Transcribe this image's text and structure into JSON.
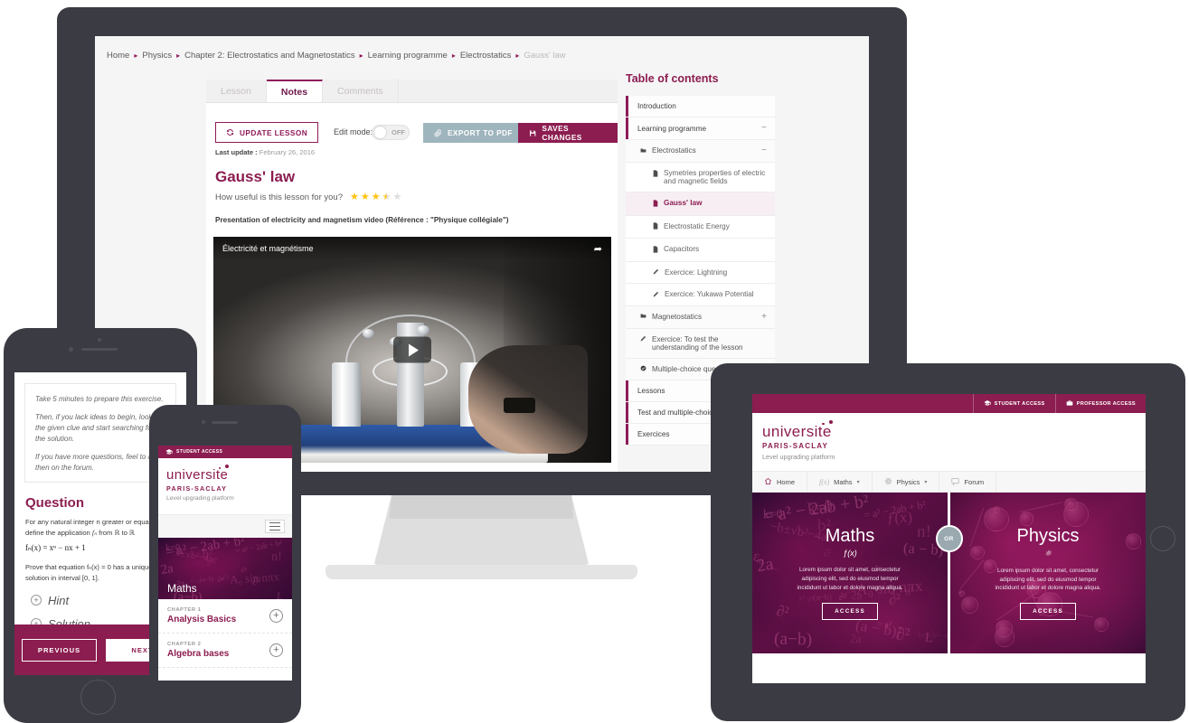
{
  "desktop": {
    "breadcrumb": [
      {
        "label": "Home",
        "current": false
      },
      {
        "label": "Physics",
        "current": false
      },
      {
        "label": "Chapter 2: Electrostatics and Magnetostatics",
        "current": false
      },
      {
        "label": "Learning programme",
        "current": false
      },
      {
        "label": "Electrostatics",
        "current": false
      },
      {
        "label": "Gauss' law",
        "current": true
      }
    ],
    "tabs": [
      {
        "label": "Lesson",
        "active": false
      },
      {
        "label": "Notes",
        "active": true
      },
      {
        "label": "Comments",
        "active": false
      }
    ],
    "toolbar": {
      "update_label": "UPDATE LESSON",
      "update_icon": "refresh-icon",
      "last_update_prefix": "Last update :",
      "last_update_value": "February 26, 2016",
      "edit_mode_label": "Edit mode:",
      "toggle_state": "OFF",
      "export_label": "EXPORT TO PDF",
      "export_icon": "paperclip-icon",
      "save_label": "SAVES CHANGES",
      "save_icon": "floppy-disk-icon"
    },
    "lesson": {
      "title": "Gauss' law",
      "rating_question": "How useful is this lesson for you?",
      "rating_value": 3.5,
      "rating_max": 5,
      "video_caption": "Presentation of electricity and magnetism video (Référence : \"Physique collégiale\")",
      "video_title": "Électricité et magnétisme"
    },
    "toc": {
      "title": "Table of contents",
      "items": [
        {
          "label": "Introduction",
          "level": 0,
          "icon": "",
          "toggle": "",
          "active": false
        },
        {
          "label": "Learning programme",
          "level": 0,
          "icon": "",
          "toggle": "−",
          "active": false
        },
        {
          "label": "Electrostatics",
          "level": 1,
          "icon": "folder-icon",
          "toggle": "−",
          "active": false
        },
        {
          "label": "Symetries properties of electric and magnetic fields",
          "level": 2,
          "icon": "document-icon",
          "toggle": "",
          "active": false
        },
        {
          "label": "Gauss' law",
          "level": 2,
          "icon": "document-icon",
          "toggle": "",
          "active": true
        },
        {
          "label": "Electrostatic Energy",
          "level": 2,
          "icon": "document-icon",
          "toggle": "",
          "active": false
        },
        {
          "label": "Capacitors",
          "level": 2,
          "icon": "document-icon",
          "toggle": "",
          "active": false
        },
        {
          "label": "Exercice: Lightning",
          "level": 2,
          "icon": "pencil-icon",
          "toggle": "",
          "active": false
        },
        {
          "label": "Exercice: Yukawa Potential",
          "level": 2,
          "icon": "pencil-icon",
          "toggle": "",
          "active": false
        },
        {
          "label": "Magnetostatics",
          "level": 1,
          "icon": "folder-icon",
          "toggle": "+",
          "active": false
        },
        {
          "label": "Exercice: To test the understanding of the lesson",
          "level": 1,
          "icon": "pencil-icon",
          "toggle": "",
          "active": false
        },
        {
          "label": "Multiple-choice questions",
          "level": 1,
          "icon": "check-circle-icon",
          "toggle": "",
          "active": false
        },
        {
          "label": "Lessons",
          "level": 0,
          "icon": "",
          "toggle": "",
          "active": false
        },
        {
          "label": "Test and multiple-choice questions",
          "level": 0,
          "icon": "",
          "toggle": "",
          "active": false
        },
        {
          "label": "Exercices",
          "level": 0,
          "icon": "",
          "toggle": "",
          "active": false
        }
      ]
    }
  },
  "tablet": {
    "topbar": [
      {
        "label": "STUDENT ACCESS",
        "icon": "graduation-cap-icon"
      },
      {
        "label": "PROFESSOR ACCESS",
        "icon": "briefcase-icon"
      }
    ],
    "logo": {
      "name": "universite",
      "subtitle": "PARIS-SACLAY",
      "tagline": "Level upgrading platform"
    },
    "nav": [
      {
        "label": "Home",
        "icon": "home-icon",
        "caret": false
      },
      {
        "label": "Maths",
        "icon": "fx-icon",
        "caret": true
      },
      {
        "label": "Physics",
        "icon": "atom-icon",
        "caret": true
      },
      {
        "label": "Forum",
        "icon": "speech-bubble-icon",
        "caret": false
      }
    ],
    "or_divider": "OR",
    "hero": [
      {
        "heading": "Maths",
        "icon_glyph": "ƒ(x)",
        "text": "Lorem ipsum dolor sit amet, consectetur adipiscing elit, sed do eiusmod tempor incididunt ut labor et dolore magna aliqua.",
        "button": "ACCESS"
      },
      {
        "heading": "Physics",
        "icon_glyph": "⚛",
        "text": "Lorem ipsum dolor sit amet, consectetur adipiscing elit, sed do eiusmod tempor incididunt ut labor et dolore magna aliqua.",
        "button": "ACCESS"
      }
    ]
  },
  "phone_large": {
    "notes": [
      "Take 5 minutes to prepare this exercise.",
      "Then, if you lack ideas to begin, look at the given clue and start searching for the solution.",
      "If you have more questions, feel to ask then on the forum."
    ],
    "question_title": "Question",
    "question_line1": "For any natural integer n greater or equal, we define the application",
    "question_fn": "fₙ",
    "question_line2": "from ℝ to ℝ",
    "question_eq1": "fₙ(x) = xⁿ − nx + 1",
    "question_line3": "Prove that equation fₙ(x) = 0 has a unique solution in interval [0, 1].",
    "accordions": [
      {
        "label": "Hint",
        "icon": "plus-circle-icon"
      },
      {
        "label": "Solution",
        "icon": "plus-circle-icon"
      }
    ],
    "prev_label": "PREVIOUS",
    "next_label": "NEXT"
  },
  "phone_small": {
    "topbar_label": "STUDENT ACCESS",
    "topbar_icon": "graduation-cap-icon",
    "logo": {
      "name": "universite",
      "subtitle": "PARIS-SACLAY",
      "tagline": "Level upgrading platform"
    },
    "menu_icon": "hamburger-menu-icon",
    "hero_heading": "Maths",
    "chapters": [
      {
        "eyebrow": "CHAPTER 1",
        "title": "Analysis Basics",
        "icon": "plus-circle-icon"
      },
      {
        "eyebrow": "CHAPTER 2",
        "title": "Algebra bases",
        "icon": "plus-circle-icon"
      }
    ]
  },
  "colors": {
    "brand": "#8c1d50",
    "brand_dark": "#6e1648",
    "device_frame": "#3b3b44",
    "export_button": "#9fb5bd",
    "star": "#ffc20e"
  }
}
